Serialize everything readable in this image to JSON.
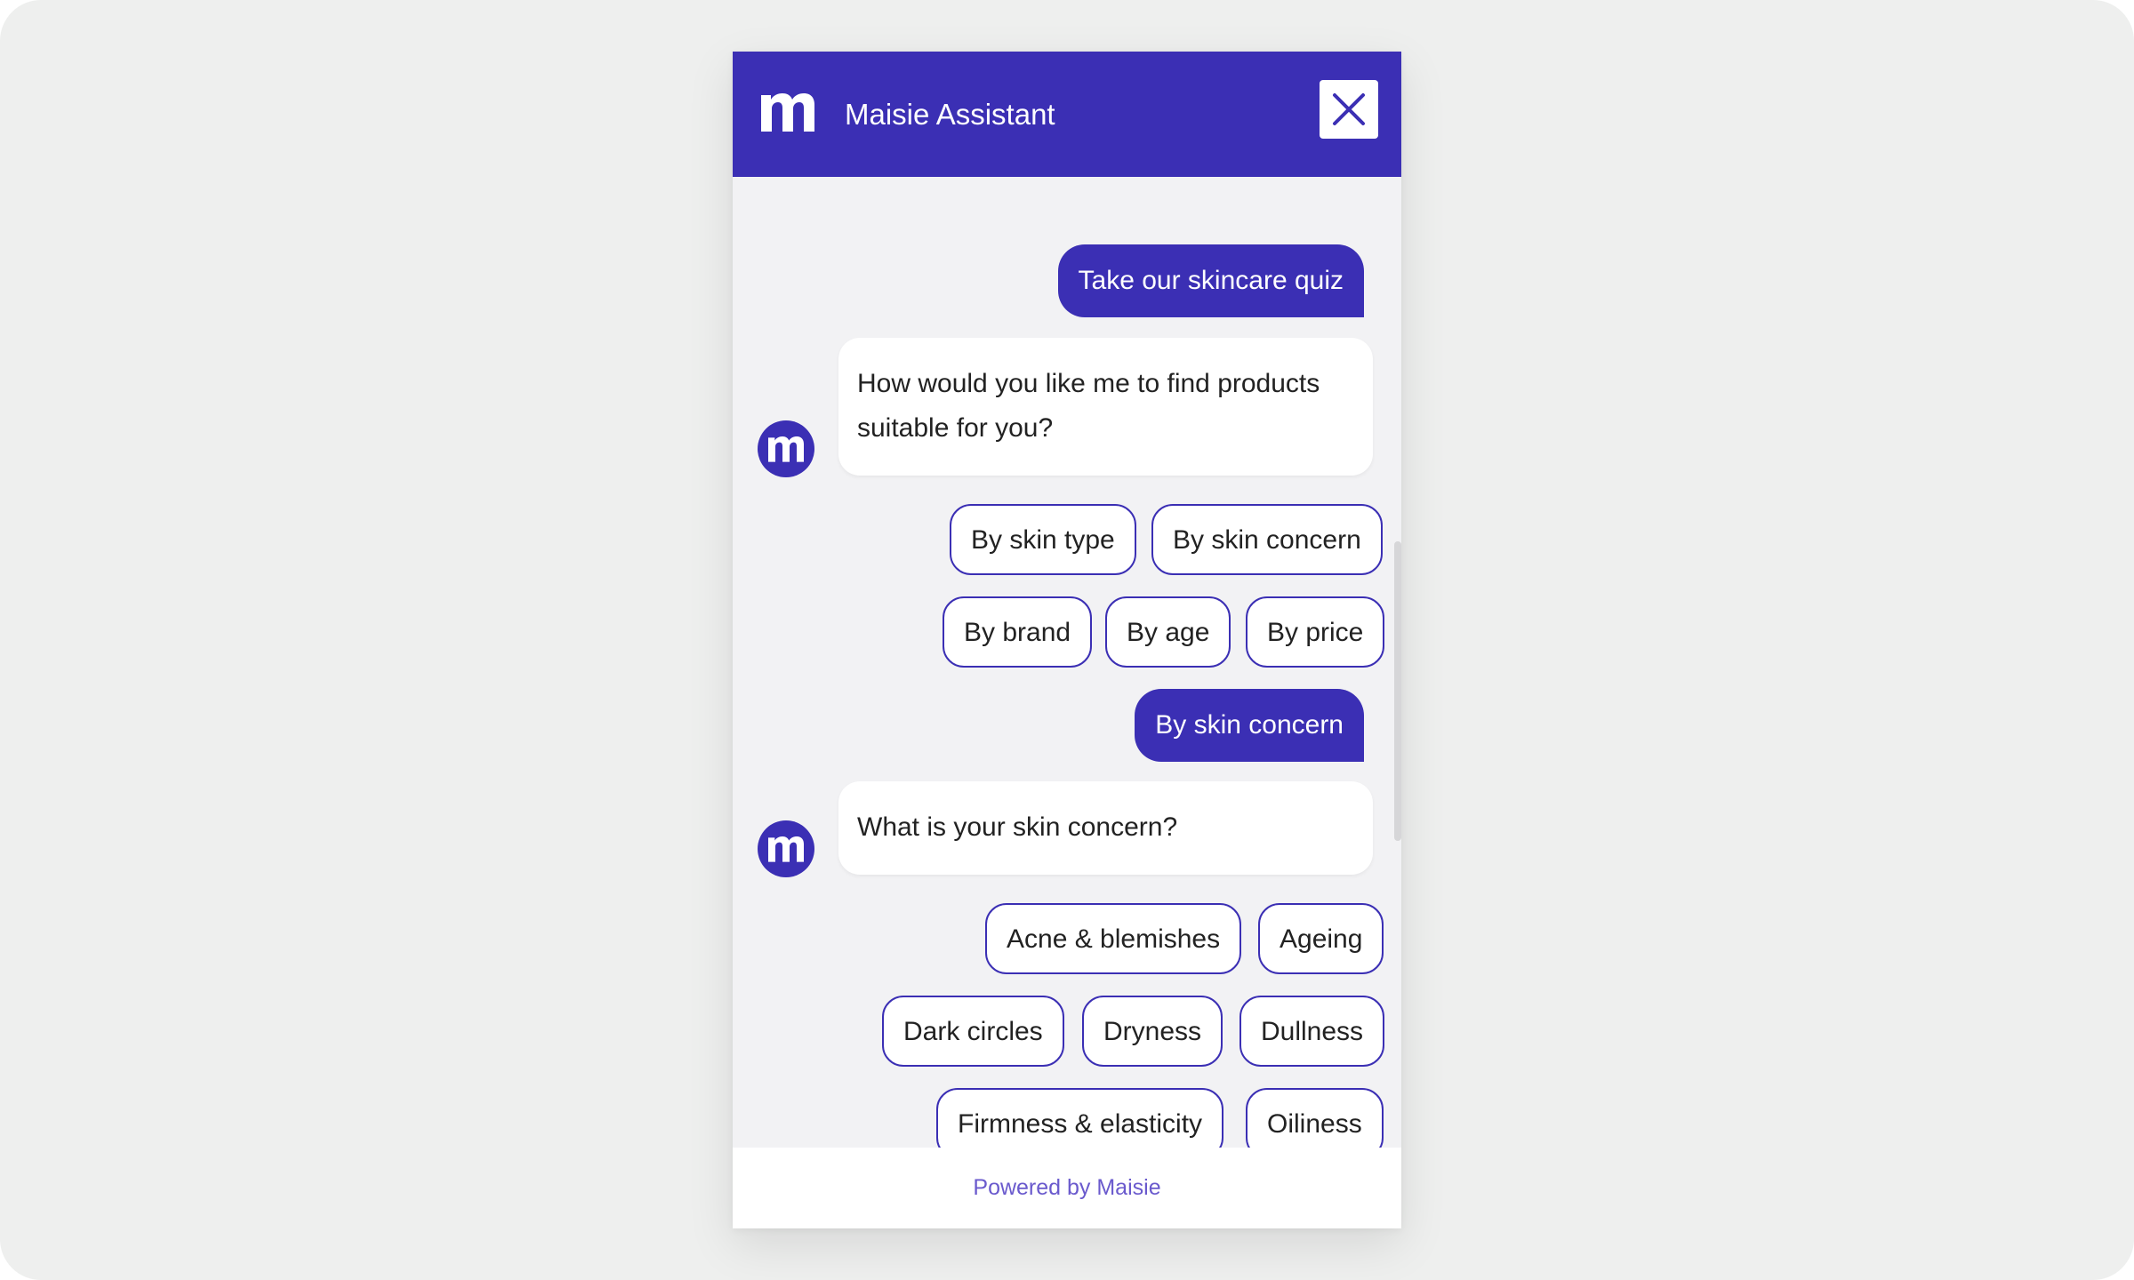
{
  "header": {
    "logo_icon": "maisie-m-logo",
    "title": "Maisie Assistant",
    "close_icon": "close-icon"
  },
  "messages": {
    "user_1": "Take our skincare quiz",
    "bot_1": "How would you like me to find products suitable for you?",
    "options_1": [
      "By skin type",
      "By skin concern",
      "By brand",
      "By age",
      "By price"
    ],
    "user_2": "By skin concern",
    "bot_2": "What is your skin concern?",
    "options_2": [
      "Acne & blemishes",
      "Ageing",
      "Dark circles",
      "Dryness",
      "Dullness",
      "Firmness & elasticity",
      "Oiliness",
      ""
    ]
  },
  "footer": {
    "powered_by": "Powered by Maisie"
  },
  "colors": {
    "brand": "#3b2fb4",
    "chat_background": "#f2f2f4",
    "page_background": "#eeefee",
    "footer_text": "#6a5acd"
  }
}
